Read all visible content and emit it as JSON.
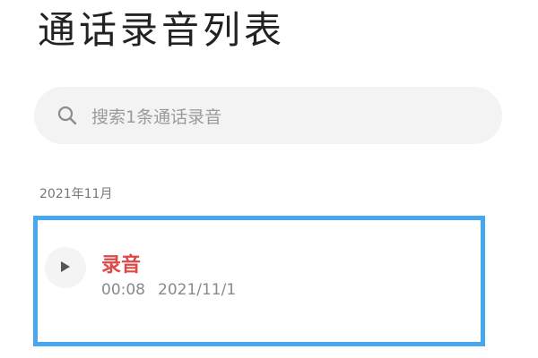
{
  "header": {
    "title": "通话录音列表"
  },
  "search": {
    "placeholder": "搜索1条通话录音",
    "icon": "search-icon"
  },
  "sections": [
    {
      "label": "2021年11月",
      "items": [
        {
          "title": "录音",
          "duration": "00:08",
          "date": "2021/11/1",
          "icon": "play-icon"
        }
      ]
    }
  ],
  "colors": {
    "title_red": "#e04848",
    "highlight_border": "#45a8f0",
    "search_bg": "#f3f3f3"
  }
}
